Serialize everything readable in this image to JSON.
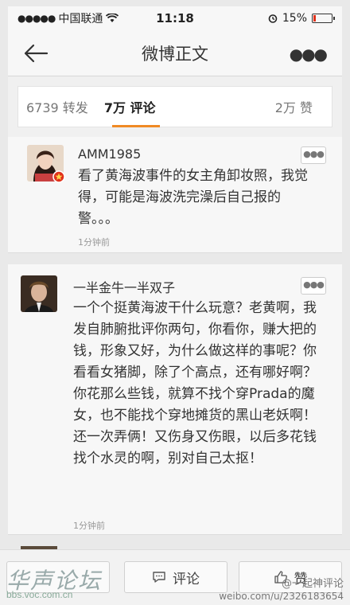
{
  "status": {
    "carrier": "中国联通",
    "time": "11:18",
    "battery": "15%",
    "battery_level": 0.15,
    "battery_color": "#e0311b"
  },
  "nav": {
    "title": "微博正文",
    "back_icon": "back-arrow-icon",
    "more_icon": "more-dots-icon"
  },
  "tabs": {
    "reposts": "6739 转发",
    "comments": "7万 评论",
    "likes": "2万 赞",
    "active_color": "#f08a24"
  },
  "comments": [
    {
      "user": "AMM1985",
      "text": "看了黄海波事件的女主角卸妆照，我觉得，可能是海波洗完澡后自己报的警。。。",
      "time": "1分钟前"
    },
    {
      "user": "一半金牛一半双子",
      "text": "一个个挺黄海波干什么玩意？老黄啊，我发自肺腑批评你两句，你看你，赚大把的钱，形象又好，为什么做这样的事呢？你看看女猪脚，除了个高点，还有哪好啊？你花那么些钱，就算不找个穿Prada的魔女，也不能找个穿地摊货的黑山老妖啊！还一次弄俩！又伤身又伤眼，以后多花钱找个水灵的啊，别对自己太抠！",
      "time": "1分钟前"
    }
  ],
  "bottom": {
    "comment_label": "评论",
    "like_label": "赞"
  },
  "watermarks": {
    "forum_name": "华声论坛",
    "forum_url": "bbs.voc.com.cn",
    "weibo_name": "@一起神评论",
    "weibo_url": "weibo.com/u/2326183654"
  }
}
